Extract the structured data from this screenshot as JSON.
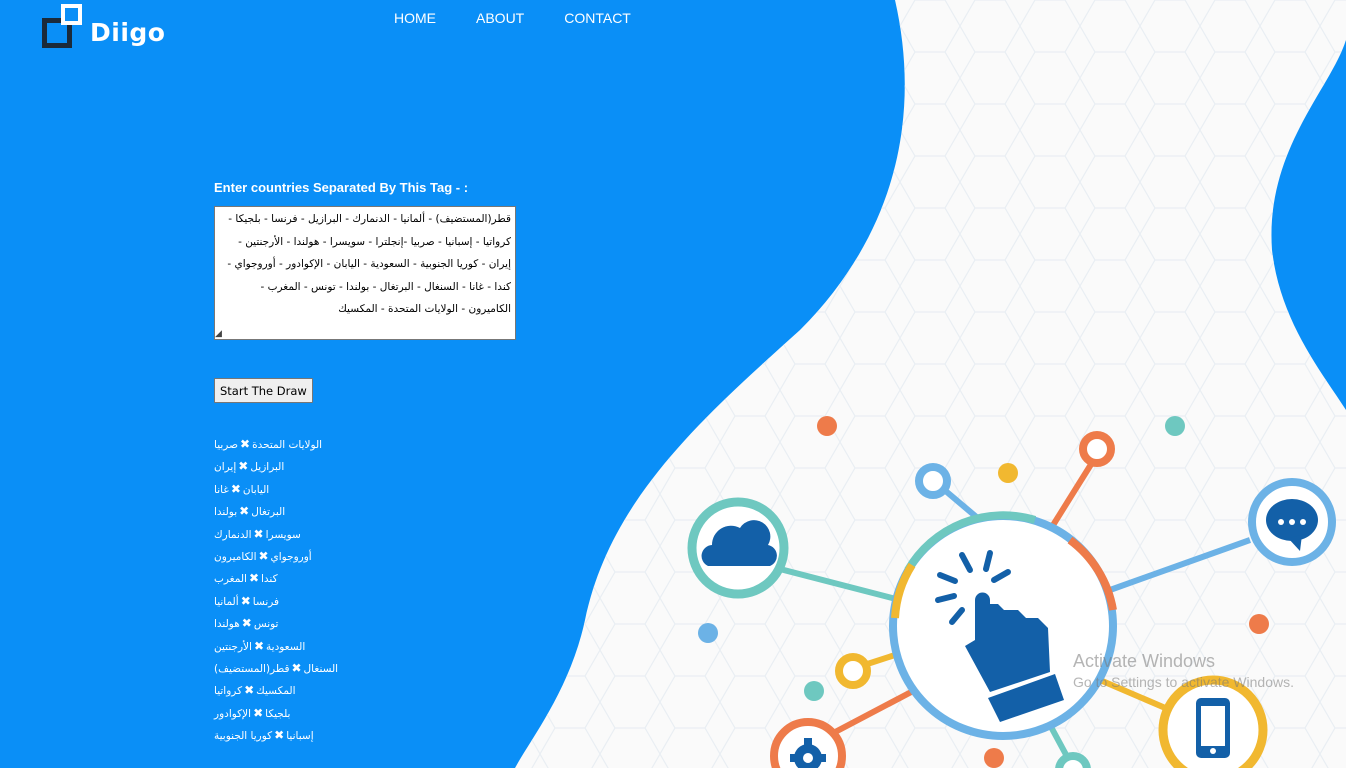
{
  "brand": {
    "name": "Diigo"
  },
  "nav": {
    "items": [
      "HOME",
      "ABOUT",
      "CONTACT"
    ]
  },
  "form": {
    "label": "Enter countries Separated By This Tag - :",
    "countries_value": "قطر(المستضيف) - ألمانيا - الدنمارك - البرازيل - فرنسا - بلجيكا - كرواتيا - إسبانيا - صربيا -إنجلترا - سويسرا - هولندا - الأرجنتين - إيران - كوريا الجنوبية - السعودية - اليابان - الإكوادور - أوروجواي - كندا - غانا - السنغال - البرتغال - بولندا - تونس - المغرب - الكاميرون - الولايات المتحدة - المكسيك",
    "start_button": "Start The Draw"
  },
  "pairs": [
    [
      "صربيا",
      "الولايات المتحدة"
    ],
    [
      "إيران",
      "البرازيل"
    ],
    [
      "غانا",
      "اليابان"
    ],
    [
      "بولندا",
      "البرتغال"
    ],
    [
      "الدنمارك",
      "سويسرا"
    ],
    [
      "الكاميرون",
      "أوروجواي"
    ],
    [
      "المغرب",
      "كندا"
    ],
    [
      "ألمانيا",
      "فرنسا"
    ],
    [
      "هولندا",
      "تونس"
    ],
    [
      "الأرجنتين",
      "السعودية"
    ],
    [
      "قطر(المستضيف)",
      "السنغال"
    ],
    [
      "كرواتيا",
      "المكسيك"
    ],
    [
      "الإكوادور",
      "بلجيكا"
    ],
    [
      "كوريا الجنوبية",
      "إسبانيا"
    ]
  ],
  "pair_separator": "✖",
  "watermark": {
    "title": "Activate Windows",
    "subtitle": "Go to Settings to activate Windows."
  },
  "colors": {
    "primary_blue": "#0a8ff7",
    "accent_orange": "#ee7b4a",
    "accent_teal": "#6ec8c0",
    "accent_yellow": "#f1b830",
    "accent_sky": "#6cb2e6",
    "icon_navy": "#1360a8"
  },
  "icons": [
    "cloud-icon",
    "chat-icon",
    "pointer-hand-icon",
    "gear-icon",
    "phone-icon"
  ]
}
